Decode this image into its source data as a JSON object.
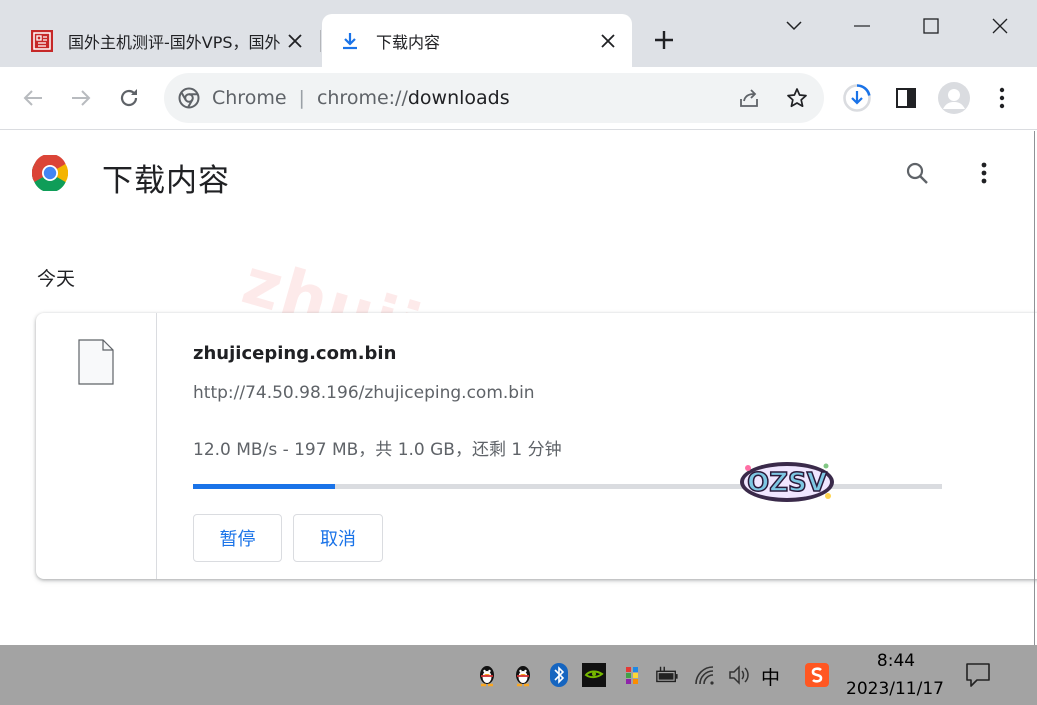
{
  "tabs": [
    {
      "title": "国外主机测评-国外VPS，国外",
      "favicon": "site-seal-icon",
      "active": false
    },
    {
      "title": "下载内容",
      "favicon": "download-icon",
      "active": true
    }
  ],
  "toolbar": {
    "site_chip": "Chrome",
    "url_scheme": "chrome://",
    "url_host": "downloads"
  },
  "page": {
    "title": "下载内容",
    "section_date": "今天"
  },
  "download": {
    "file_name": "zhujiceping.com.bin",
    "url": "http://74.50.98.196/zhujiceping.com.bin",
    "status": "12.0 MB/s - 197 MB，共 1.0 GB，还剩 1 分钟",
    "progress": 0.19,
    "pause_label": "暂停",
    "cancel_label": "取消"
  },
  "watermark": "zhujiceping.com",
  "taskbar": {
    "ime": "中",
    "time": "8:44",
    "date": "2023/11/17"
  },
  "colors": {
    "accent": "#1a73e8",
    "tabstrip": "#dee1e6",
    "taskbar": "#a3a3a3"
  }
}
